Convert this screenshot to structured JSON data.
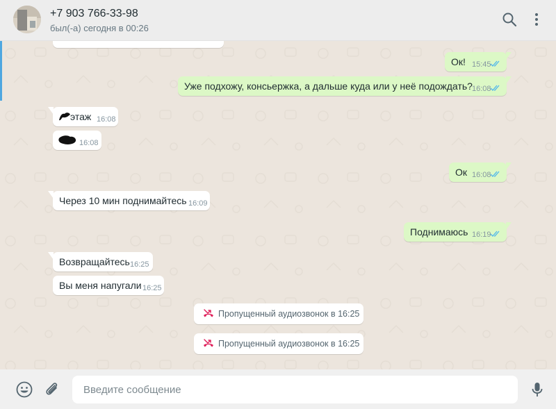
{
  "header": {
    "contact_name": "+7 903 766-33-98",
    "status": "был(-а) сегодня в 00:26",
    "avatar_icon": "contact-avatar-photo",
    "search_icon": "search-icon",
    "menu_icon": "kebab-menu-icon"
  },
  "messages": [
    {
      "dir": "out",
      "text": "Ок!",
      "time": "15:45",
      "read": true
    },
    {
      "dir": "out",
      "text": "Уже подхожу, консьержка, а дальше куда или у неё подождать?",
      "time": "16:08",
      "read": true
    },
    {
      "dir": "in",
      "text": "этаж",
      "time": "16:08",
      "redacted_prefix": true
    },
    {
      "dir": "in",
      "text": "",
      "time": "16:08",
      "redacted": true
    },
    {
      "dir": "out",
      "text": "Ок",
      "time": "16:08",
      "read": true
    },
    {
      "dir": "in",
      "text": "Через 10 мин поднимайтесь",
      "time": "16:09"
    },
    {
      "dir": "out",
      "text": "Поднимаюсь",
      "time": "16:19",
      "read": true
    },
    {
      "dir": "in",
      "text": "Возвращайтесь",
      "time": "16:25"
    },
    {
      "dir": "in",
      "text": "Вы меня напугали",
      "time": "16:25"
    }
  ],
  "system_messages": [
    {
      "icon": "missed-call-icon",
      "text": "Пропущенный аудиозвонок в 16:25"
    },
    {
      "icon": "missed-call-icon",
      "text": "Пропущенный аудиозвонок в 16:25"
    }
  ],
  "composer": {
    "placeholder": "Введите сообщение",
    "value": "",
    "emoji_icon": "emoji-icon",
    "attach_icon": "paperclip-icon",
    "mic_icon": "microphone-icon"
  },
  "colors": {
    "outgoing_bubble": "#dcf8c6",
    "incoming_bubble": "#ffffff",
    "chat_background": "#ece5dd",
    "read_ticks": "#4fb6ec",
    "missed_call": "#e0245e"
  }
}
